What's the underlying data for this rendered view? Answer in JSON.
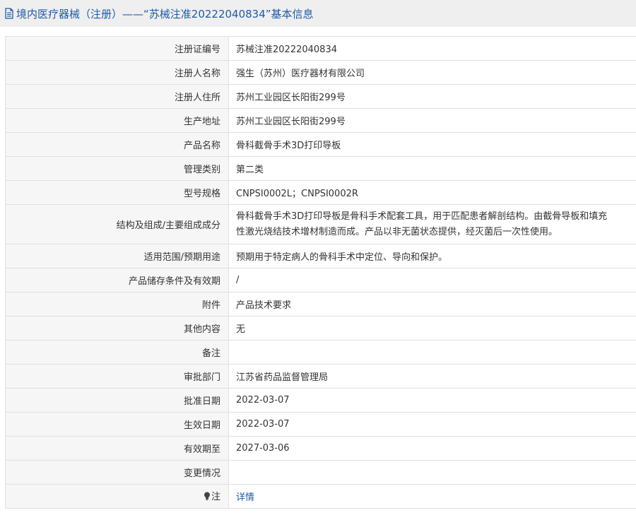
{
  "header": {
    "title": "境内医疗器械（注册）——“苏械注准20222040834”基本信息"
  },
  "rows": [
    {
      "label": "注册证编号",
      "value": "苏械注准20222040834"
    },
    {
      "label": "注册人名称",
      "value": "强生（苏州）医疗器材有限公司"
    },
    {
      "label": "注册人住所",
      "value": "苏州工业园区长阳街299号"
    },
    {
      "label": "生产地址",
      "value": "苏州工业园区长阳街299号"
    },
    {
      "label": "产品名称",
      "value": "骨科截骨手术3D打印导板"
    },
    {
      "label": "管理类别",
      "value": "第二类"
    },
    {
      "label": "型号规格",
      "value": "CNPSI0002L；CNPSI0002R"
    },
    {
      "label": "结构及组成/主要组成成分",
      "value_line1": "骨科截骨手术3D打印导板是骨科手术配套工具，用于匹配患者解剖结构。由截骨导板和填充",
      "value_line2": "性激光烧结技术增材制造而成。产品以非无菌状态提供，经灭菌后一次性使用。"
    },
    {
      "label": "适用范围/预期用途",
      "value": "预期用于特定病人的骨科手术中定位、导向和保护。"
    },
    {
      "label": "产品储存条件及有效期",
      "value": "/"
    },
    {
      "label": "附件",
      "value": "产品技术要求"
    },
    {
      "label": "其他内容",
      "value": "无"
    },
    {
      "label": "备注",
      "value": ""
    },
    {
      "label": "审批部门",
      "value": "江苏省药品监督管理局"
    },
    {
      "label": "批准日期",
      "value": "2022-03-07"
    },
    {
      "label": "生效日期",
      "value": "2022-03-07"
    },
    {
      "label": "有效期至",
      "value": "2027-03-06"
    },
    {
      "label": "变更情况",
      "value": ""
    },
    {
      "label": "注",
      "value": "详情"
    }
  ],
  "colors": {
    "title": "#1e5aa8",
    "link": "#1e5aa8",
    "label_bg": "#f6f6f6",
    "border": "#e0e0e0",
    "header_bg": "#efefef"
  },
  "icons": {
    "title_icon": "document-icon",
    "note_icon": "lightbulb-icon"
  }
}
